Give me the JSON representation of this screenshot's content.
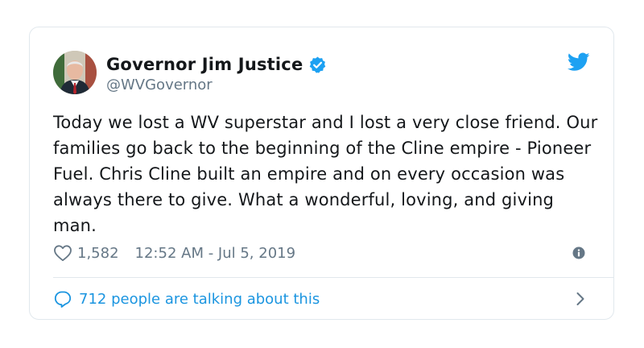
{
  "tweet": {
    "display_name": "Governor Jim Justice",
    "handle": "@WVGovernor",
    "text": "Today we lost a WV superstar and I lost a very close friend. Our families go back to the beginning of the Cline empire - Pioneer Fuel. Chris Cline built an empire and on every occasion was always there to give. What a wonderful, loving, and giving man.",
    "likes": "1,582",
    "timestamp": "12:52 AM - Jul 5, 2019",
    "talking": "712 people are talking about this"
  },
  "icons": {
    "verified": "verified-badge-icon",
    "logo": "twitter-bird-icon",
    "like": "heart-icon",
    "info": "info-icon",
    "reply": "speech-bubble-icon",
    "chevron": "chevron-right-icon"
  },
  "colors": {
    "accent": "#1b95e0",
    "verified": "#1da1f2",
    "text": "#14171a",
    "muted": "#657786",
    "border": "#e1e8ed"
  }
}
